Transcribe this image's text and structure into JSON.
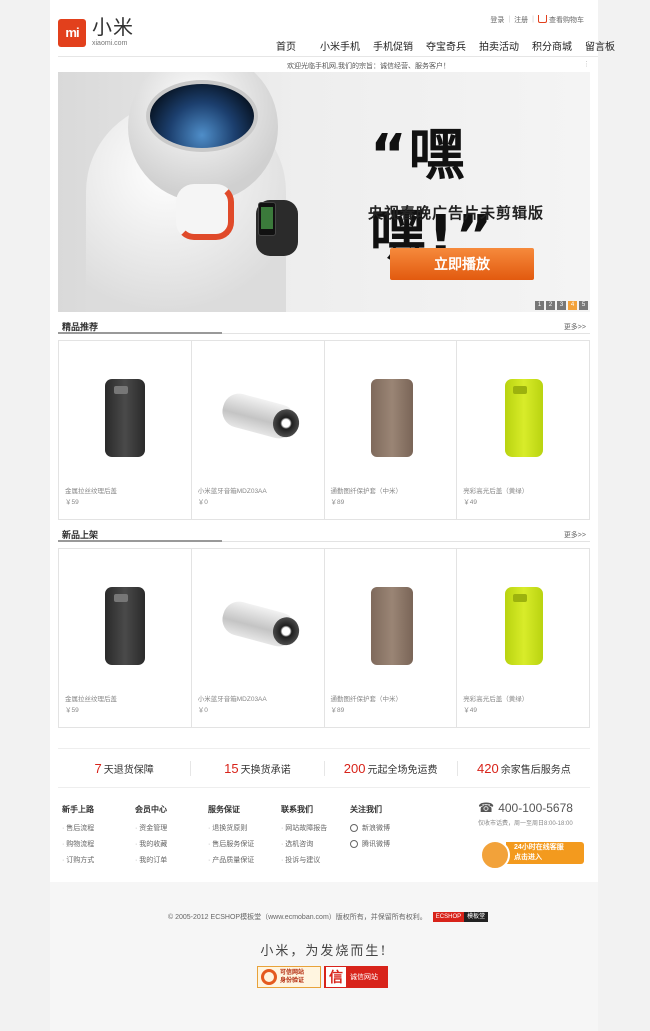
{
  "header": {
    "logo_mark": "mi",
    "logo_cn": "小米",
    "logo_en": "xiaomi.com",
    "login": "登录",
    "register": "注册",
    "cart": "查看购物车",
    "welcome": "欢迎光临手机网,我们的宗旨：诚信经营、服务客户！"
  },
  "nav": [
    "首页",
    "小米手机",
    "手机促销",
    "夺宝奇兵",
    "拍卖活动",
    "积分商城",
    "留言板"
  ],
  "banner": {
    "slogan_big": "“嘿嘿!”",
    "slogan_sub": "央视春晚广告片未剪辑版",
    "play_button": "立即播放",
    "dots": [
      "1",
      "2",
      "3",
      "4",
      "5"
    ]
  },
  "sections": [
    {
      "title": "精品推荐",
      "more": "更多>>",
      "products": [
        {
          "name": "金属拉丝纹理后盖",
          "price": "￥59",
          "image": "black-case"
        },
        {
          "name": "小米蓝牙音箱MDZ03AA",
          "price": "￥0",
          "image": "speaker"
        },
        {
          "name": "通勤图纤保护套（中米）",
          "price": "￥89",
          "image": "pouch"
        },
        {
          "name": "亮彩高光后盖（黄绿）",
          "price": "￥49",
          "image": "yellow-case"
        }
      ]
    },
    {
      "title": "新品上架",
      "more": "更多>>",
      "products": [
        {
          "name": "金属拉丝纹理后盖",
          "price": "￥59",
          "image": "black-case"
        },
        {
          "name": "小米蓝牙音箱MDZ03AA",
          "price": "￥0",
          "image": "speaker"
        },
        {
          "name": "通勤图纤保护套（中米）",
          "price": "￥89",
          "image": "pouch"
        },
        {
          "name": "亮彩高光后盖（黄绿）",
          "price": "￥49",
          "image": "yellow-case"
        }
      ]
    }
  ],
  "services": [
    {
      "num": "7",
      "text": "天退货保障"
    },
    {
      "num": "15",
      "text": "天换货承诺"
    },
    {
      "num": "200",
      "text": "元起全场免运费"
    },
    {
      "num": "420",
      "text": "余家售后服务点"
    }
  ],
  "footer": {
    "cols": [
      {
        "title": "新手上路",
        "items": [
          "售后流程",
          "购物流程",
          "订购方式"
        ]
      },
      {
        "title": "会员中心",
        "items": [
          "资金管理",
          "我的收藏",
          "我的订单"
        ]
      },
      {
        "title": "服务保证",
        "items": [
          "退换货原则",
          "售后服务保证",
          "产品质量保证"
        ]
      },
      {
        "title": "联系我们",
        "items": [
          "网站故障报告",
          "选机咨询",
          "投诉与建议"
        ]
      },
      {
        "title": "关注我们",
        "items": [
          "新浪微博",
          "腾讯微博"
        ]
      }
    ],
    "phone": "400-100-5678",
    "phone_hours": "仅收市话费，周一至周日8:00-18:00",
    "service_badge": "24小时在线客服点击进入",
    "service_badge_line1": "24小时在线客服",
    "service_badge_line2": "点击进入",
    "copyright": "© 2005-2012 ECSHOP模板堂（www.ecmoban.com）版权所有，并保留所有权利。",
    "ecshop_a": "ECSHOP",
    "ecshop_b": "模板堂",
    "motto": "小米，为发烧而生!",
    "cert1_line1": "可信网站",
    "cert1_line2": "身份验证",
    "cert2_big": "信",
    "cert2_text": "诚信网站"
  }
}
